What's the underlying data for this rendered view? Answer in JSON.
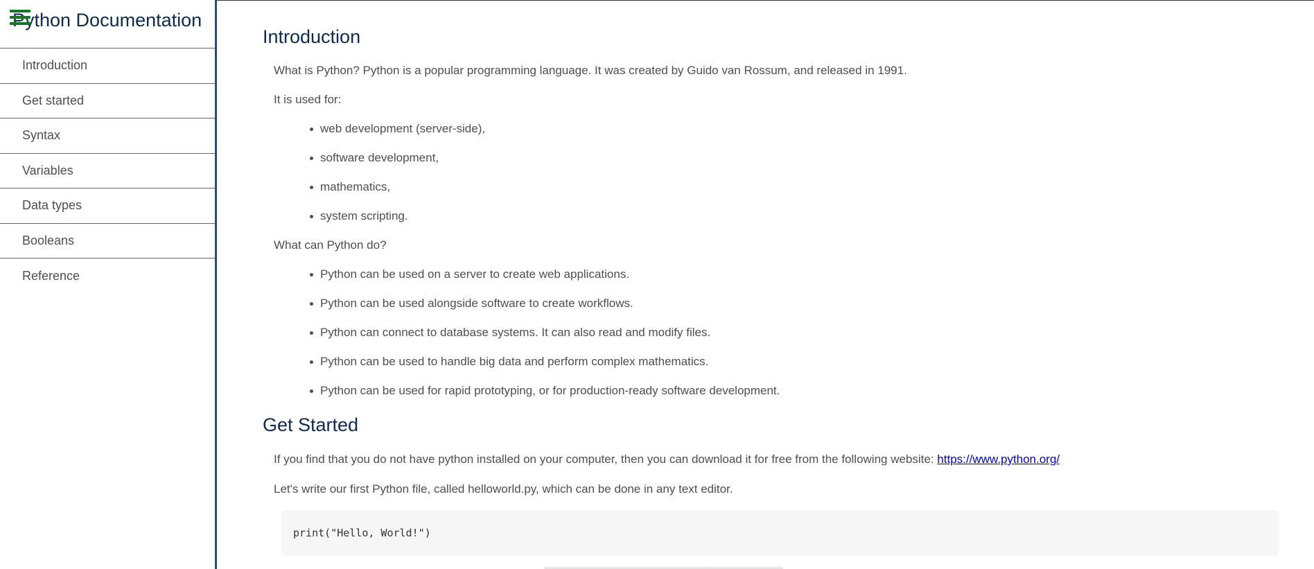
{
  "sidebar": {
    "title": "Python Documentation",
    "menu_icon": "hamburger-menu-icon",
    "items": [
      {
        "label": "Introduction"
      },
      {
        "label": "Get started"
      },
      {
        "label": "Syntax"
      },
      {
        "label": "Variables"
      },
      {
        "label": "Data types"
      },
      {
        "label": "Booleans"
      },
      {
        "label": "Reference"
      }
    ]
  },
  "introduction": {
    "title": "Introduction",
    "intro_text": "What is Python? Python is a popular programming language. It was created by Guido van Rossum, and released in 1991.",
    "used_for_label": "It is used for:",
    "used_for": [
      "web development (server-side),",
      "software development,",
      "mathematics,",
      "system scripting."
    ],
    "can_do_label": "What can Python do?",
    "can_do": [
      "Python can be used on a server to create web applications.",
      "Python can be used alongside software to create workflows.",
      "Python can connect to database systems. It can also read and modify files.",
      "Python can be used to handle big data and perform complex mathematics.",
      "Python can be used for rapid prototyping, or for production-ready software development."
    ]
  },
  "get_started": {
    "title": "Get Started",
    "install_text": "If you find that you do not have python installed on your computer, then you can download it for free from the following website: ",
    "install_link": "https://www.python.org/",
    "first_file_text": "Let's write our first Python file, called helloworld.py, which can be done in any text editor.",
    "code": "print(\"Hello, World!\")"
  },
  "colors": {
    "heading": "#0d2a50",
    "body_text": "#4d4e53",
    "sidebar_border": "#2b4a7a",
    "menu_icon": "#15791f",
    "link": "#0000ee",
    "code_bg": "#f6f6f6"
  }
}
